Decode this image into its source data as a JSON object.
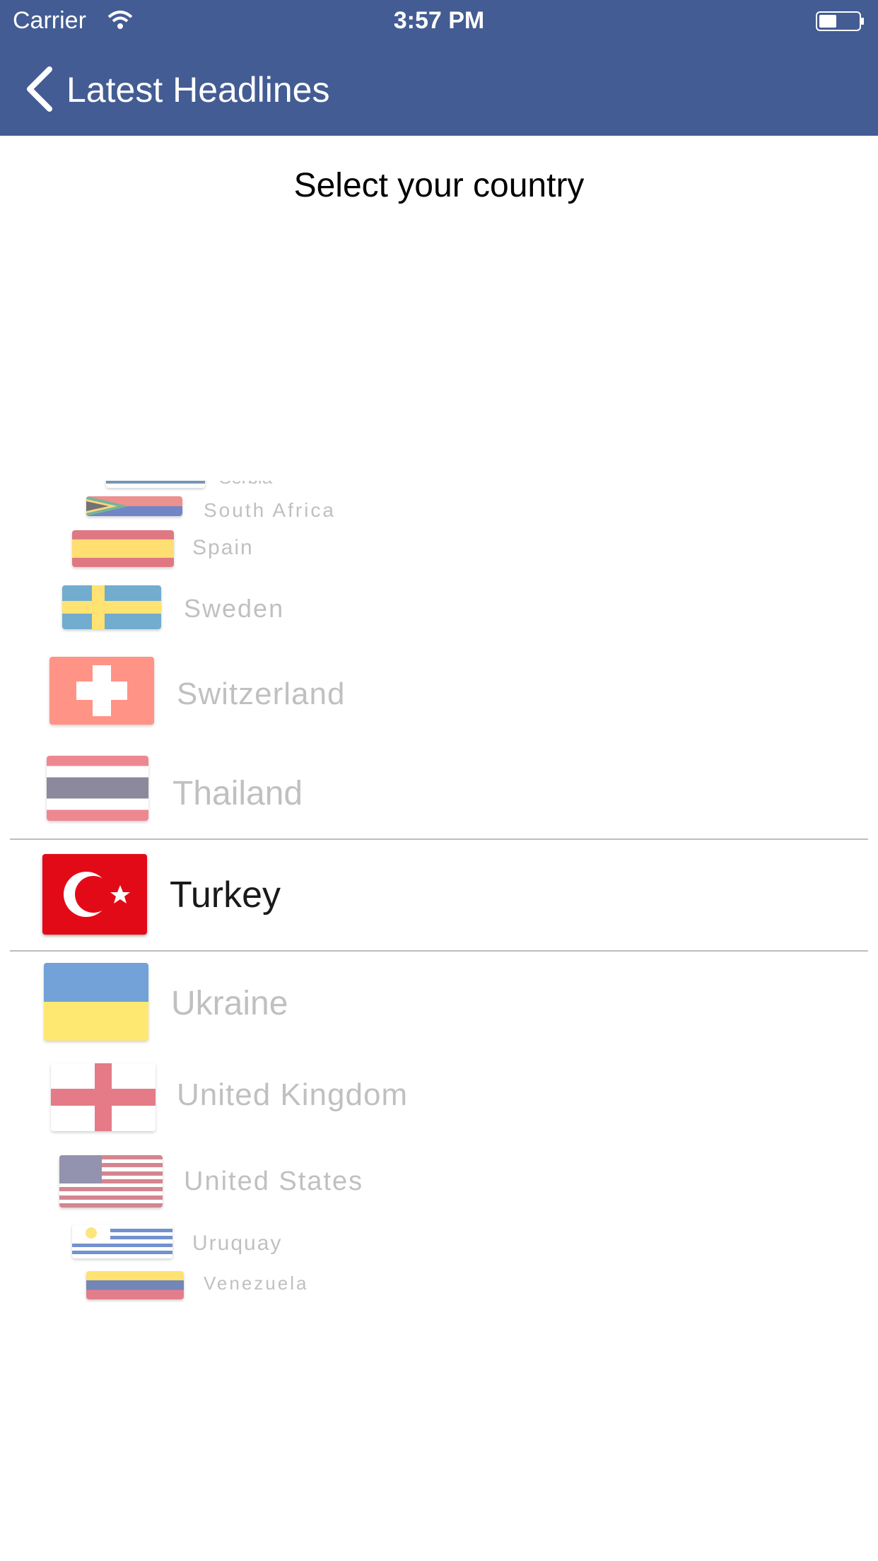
{
  "status_bar": {
    "carrier": "Carrier",
    "time": "3:57 PM"
  },
  "nav": {
    "title": "Latest Headlines"
  },
  "page": {
    "title": "Select your country"
  },
  "picker": {
    "partial_top": "Serbia",
    "items": [
      {
        "name": "South Africa"
      },
      {
        "name": "Spain"
      },
      {
        "name": "Sweden"
      },
      {
        "name": "Switzerland"
      },
      {
        "name": "Thailand"
      },
      {
        "name": "Turkey",
        "selected": true
      },
      {
        "name": "Ukraine"
      },
      {
        "name": "United Kingdom"
      },
      {
        "name": "United States"
      },
      {
        "name": "Uruquay"
      },
      {
        "name": "Venezuela"
      }
    ]
  },
  "colors": {
    "nav_bar": "#435c93",
    "selected_text": "#1a1a1a",
    "faded_text": "#8d8d8d"
  }
}
